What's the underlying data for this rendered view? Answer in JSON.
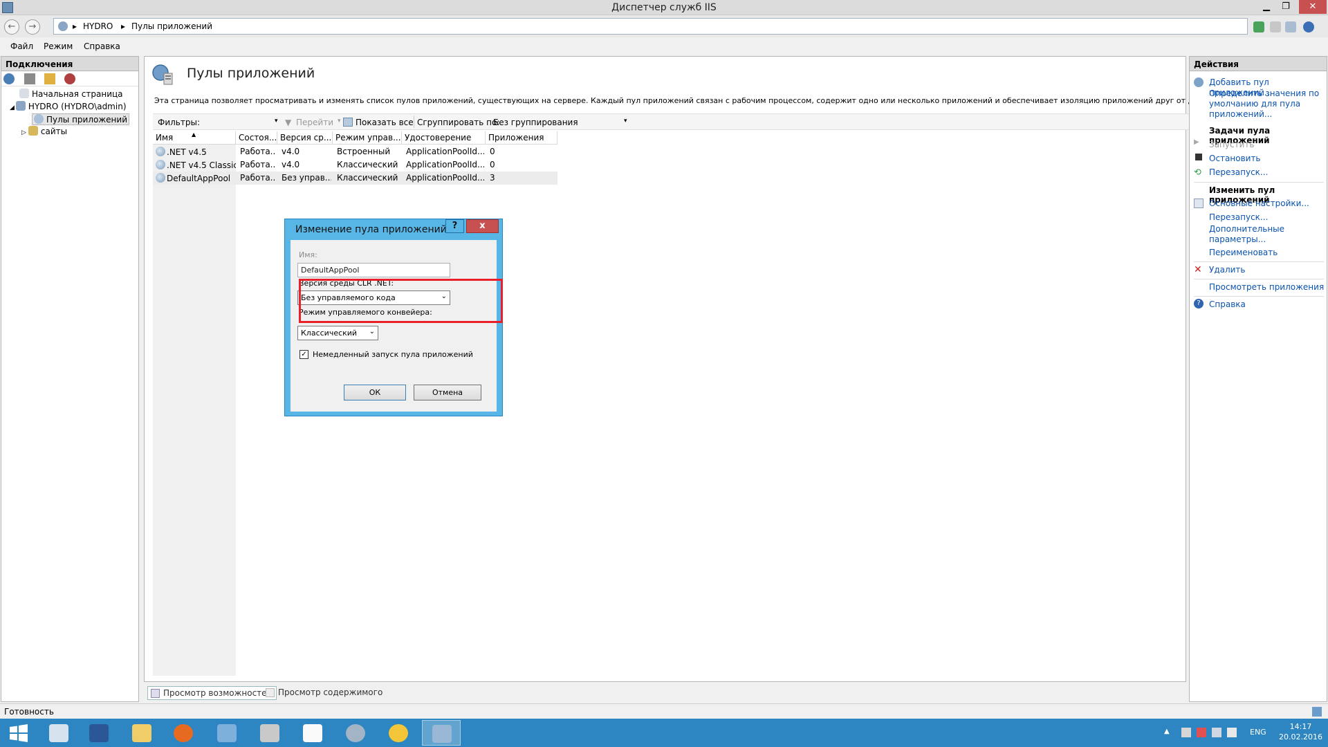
{
  "window": {
    "title": "Диспетчер служб IIS"
  },
  "address": {
    "crumbs": [
      "HYDRO",
      "Пулы приложений"
    ]
  },
  "menu": [
    "Файл",
    "Режим",
    "Справка"
  ],
  "connections": {
    "header": "Подключения",
    "tree": [
      "Начальная страница",
      "HYDRO (HYDRO\\admin)",
      "Пулы приложений",
      "сайты"
    ]
  },
  "page": {
    "title": "Пулы приложений",
    "description": "Эта страница позволяет просматривать и изменять список пулов приложений, существующих на сервере. Каждый пул приложений связан с рабочим процессом, содержит одно или несколько приложений и обеспечивает изоляцию приложений друг от друга.",
    "filter_label": "Фильтры:",
    "go_label": "Перейти",
    "show_all_label": "Показать все",
    "group_by_label": "Сгруппировать по:",
    "group_by_value": "Без группирования"
  },
  "grid": {
    "columns": [
      "Имя",
      "Состоя...",
      "Версия ср...",
      "Режим управ...",
      "Удостоверение",
      "Приложения"
    ],
    "rows": [
      {
        "name": ".NET v4.5",
        "state": "Работа...",
        "clr": "v4.0",
        "mode": "Встроенный",
        "identity": "ApplicationPoolId...",
        "apps": "0"
      },
      {
        "name": ".NET v4.5 Classic",
        "state": "Работа...",
        "clr": "v4.0",
        "mode": "Классический",
        "identity": "ApplicationPoolId...",
        "apps": "0"
      },
      {
        "name": "DefaultAppPool",
        "state": "Работа...",
        "clr": "Без управ...",
        "mode": "Классический",
        "identity": "ApplicationPoolId...",
        "apps": "3"
      }
    ]
  },
  "view_tabs": [
    "Просмотр возможностей",
    "Просмотр содержимого"
  ],
  "actions": {
    "header": "Действия",
    "add": "Добавить пул приложений...",
    "defaults": "Определить значения по умолчанию для пула приложений...",
    "tasks_header": "Задачи пула приложений",
    "start": "Запустить",
    "stop": "Остановить",
    "recycle": "Перезапуск...",
    "edit_header": "Изменить пул приложений",
    "basic": "Основные настройки...",
    "recycle2": "Перезапуск...",
    "advanced": "Дополнительные параметры...",
    "rename": "Переименовать",
    "delete": "Удалить",
    "view_apps": "Просмотреть приложения",
    "help": "Справка"
  },
  "status": "Готовность",
  "dialog": {
    "title": "Изменение пула приложений",
    "help_btn": "?",
    "close_btn": "x",
    "name_label": "Имя:",
    "name_value": "DefaultAppPool",
    "clr_label": "Версия среды CLR .NET:",
    "clr_value": "Без управляемого кода",
    "pipeline_label": "Режим управляемого конвейера:",
    "pipeline_value": "Классический",
    "start_now_label": "Немедленный запуск пула приложений",
    "start_now_checked": true,
    "ok": "ОК",
    "cancel": "Отмена"
  },
  "taskbar": {
    "lang": "ENG",
    "time": "14:17",
    "date": "20.02.2016"
  },
  "colors": {
    "accent": "#2d86c1",
    "dialog_frame": "#58b6e6",
    "highlight": "#e8202a",
    "link": "#0a53b0"
  }
}
